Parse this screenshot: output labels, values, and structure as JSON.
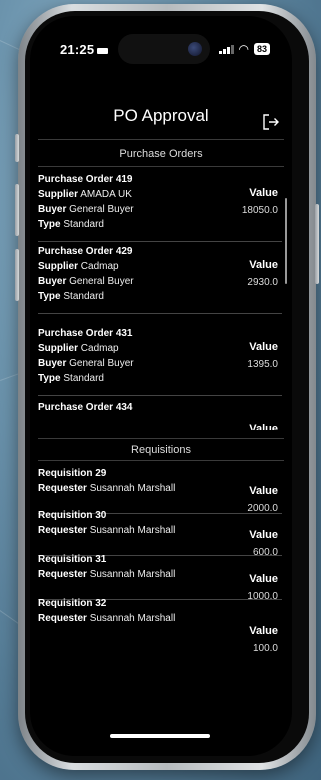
{
  "status": {
    "time": "21:25",
    "battery": "83"
  },
  "header": {
    "title": "PO Approval"
  },
  "purchase_orders": {
    "section_label": "Purchase Orders",
    "value_label": "Value",
    "items": [
      {
        "title": "Purchase Order 419",
        "supplier_label": "Supplier",
        "supplier": "AMADA UK",
        "buyer_label": "Buyer",
        "buyer": "General Buyer",
        "type_label": "Type",
        "type": "Standard",
        "value": "18050.0"
      },
      {
        "title": "Purchase Order 429",
        "supplier_label": "Supplier",
        "supplier": "Cadmap",
        "buyer_label": "Buyer",
        "buyer": "General Buyer",
        "type_label": "Type",
        "type": "Standard",
        "value": "2930.0"
      },
      {
        "title": "Purchase Order 431",
        "supplier_label": "Supplier",
        "supplier": "Cadmap",
        "buyer_label": "Buyer",
        "buyer": "General Buyer",
        "type_label": "Type",
        "type": "Standard",
        "value": "1395.0"
      },
      {
        "title": "Purchase Order 434"
      }
    ]
  },
  "requisitions": {
    "section_label": "Requisitions",
    "value_label": "Value",
    "items": [
      {
        "title": "Requisition 29",
        "requester_label": "Requester",
        "requester": "Susannah Marshall",
        "value": "2000.0"
      },
      {
        "title": "Requisition 30",
        "requester_label": "Requester",
        "requester": "Susannah Marshall",
        "value": "600.0"
      },
      {
        "title": "Requisition 31",
        "requester_label": "Requester",
        "requester": "Susannah Marshall",
        "value": "1000.0"
      },
      {
        "title": "Requisition 32",
        "requester_label": "Requester",
        "requester": "Susannah Marshall",
        "value": "100.0"
      }
    ]
  }
}
